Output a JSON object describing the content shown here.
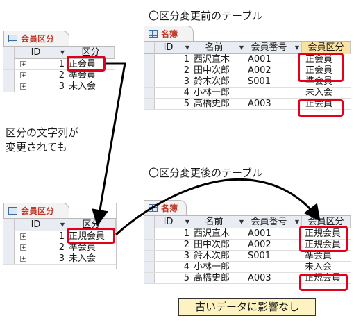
{
  "captions": {
    "before": "〇区分変更前のテーブル",
    "after": "〇区分変更後のテーブル",
    "note_line1": "区分の文字列が",
    "note_line2": "変更されても",
    "no_effect": "古いデータに影響なし"
  },
  "category_table_before": {
    "title": "会員区分",
    "columns": [
      "ID",
      "区分"
    ],
    "rows": [
      {
        "id": "1",
        "name": "正会員"
      },
      {
        "id": "2",
        "name": "準会員"
      },
      {
        "id": "3",
        "name": "未入会"
      }
    ]
  },
  "category_table_after": {
    "title": "会員区分",
    "columns": [
      "ID",
      "区分"
    ],
    "rows": [
      {
        "id": "1",
        "name": "正規会員"
      },
      {
        "id": "2",
        "name": "準会員"
      },
      {
        "id": "3",
        "name": "未入会"
      }
    ]
  },
  "roster_before": {
    "title": "名簿",
    "columns": [
      "ID",
      "名前",
      "会員番号",
      "会員区分"
    ],
    "rows": [
      {
        "id": "1",
        "name": "西沢直木",
        "number": "A001",
        "category": "正会員"
      },
      {
        "id": "2",
        "name": "田中次郎",
        "number": "A002",
        "category": "正会員"
      },
      {
        "id": "3",
        "name": "鈴木次郎",
        "number": "S001",
        "category": "準会員"
      },
      {
        "id": "4",
        "name": "小林一郎",
        "number": "",
        "category": "未入会"
      },
      {
        "id": "5",
        "name": "高橋史郎",
        "number": "A003",
        "category": "正会員"
      }
    ]
  },
  "roster_after": {
    "title": "名簿",
    "columns": [
      "ID",
      "名前",
      "会員番号",
      "会員区分"
    ],
    "rows": [
      {
        "id": "1",
        "name": "西沢直木",
        "number": "A001",
        "category": "正規会員"
      },
      {
        "id": "2",
        "name": "田中次郎",
        "number": "A002",
        "category": "正規会員"
      },
      {
        "id": "3",
        "name": "鈴木次郎",
        "number": "S001",
        "category": "準会員"
      },
      {
        "id": "4",
        "name": "小林一郎",
        "number": "",
        "category": "未入会"
      },
      {
        "id": "5",
        "name": "高橋史郎",
        "number": "A003",
        "category": "正規会員"
      }
    ]
  },
  "colors": {
    "highlight_red": "#e3001b",
    "tab_title_red": "#c0392b",
    "header_highlight": "#fbe2a0",
    "note_box_fill": "#fdf3c0"
  },
  "icons": {
    "table": "table-icon",
    "expand": "expand-plus-icon",
    "sort": "dropdown-arrow-icon"
  }
}
